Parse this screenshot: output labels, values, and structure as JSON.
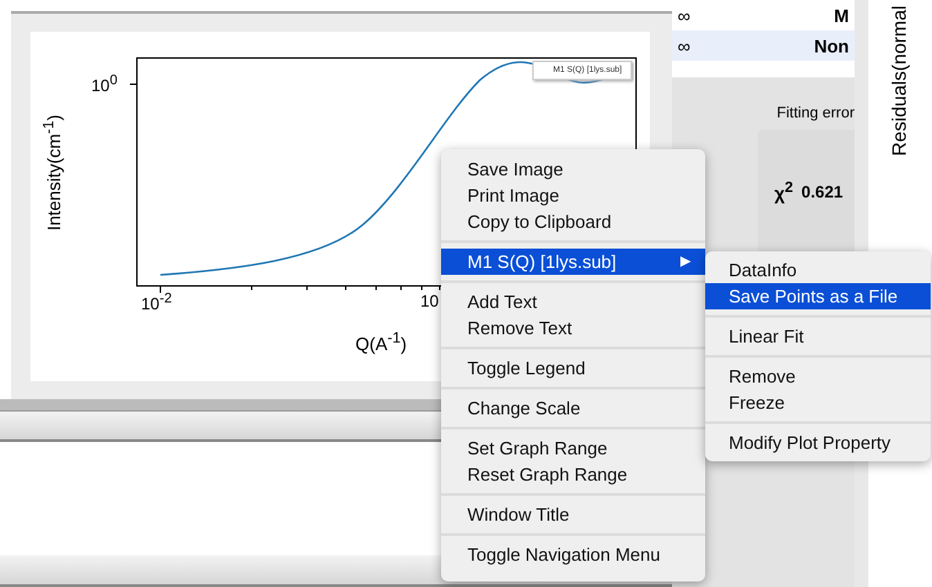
{
  "plot": {
    "y_tick": "10$^{0}$",
    "x_ticks": [
      "10$^{-2}$",
      "10"
    ],
    "ylabel": "Intensity(cm$^{-1}$)",
    "xlabel": "Q(A$^{-1}$)",
    "legend": "M1 S(Q) [1lys.sub]"
  },
  "table": {
    "rows": [
      {
        "cells": [
          "∞",
          "M"
        ],
        "selected": false
      },
      {
        "cells": [
          "∞",
          "Non"
        ],
        "selected": true
      }
    ]
  },
  "fit": {
    "label": "Fitting error",
    "chi": "χ$^{2}$",
    "value": "0.621"
  },
  "residuals_label": "Residuals(normal",
  "menu": {
    "groups": [
      {
        "items": [
          {
            "label": "Save Image",
            "selected": false
          },
          {
            "label": "Print Image",
            "selected": false
          },
          {
            "label": "Copy to Clipboard",
            "selected": false
          }
        ]
      },
      {
        "items": [
          {
            "label": "M1 S(Q) [1lys.sub]",
            "selected": true,
            "arrow": "▶"
          }
        ]
      },
      {
        "items": [
          {
            "label": "Add Text",
            "selected": false
          },
          {
            "label": "Remove Text",
            "selected": false
          }
        ]
      },
      {
        "items": [
          {
            "label": "Toggle Legend",
            "selected": false
          }
        ]
      },
      {
        "items": [
          {
            "label": "Change Scale",
            "selected": false
          }
        ]
      },
      {
        "items": [
          {
            "label": "Set Graph Range",
            "selected": false
          },
          {
            "label": "Reset Graph Range",
            "selected": false
          }
        ]
      },
      {
        "items": [
          {
            "label": "Window Title",
            "selected": false
          }
        ]
      },
      {
        "items": [
          {
            "label": "Toggle Navigation Menu",
            "selected": false
          }
        ]
      }
    ]
  },
  "submenu": {
    "groups": [
      {
        "items": [
          {
            "label": "DataInfo",
            "selected": false
          },
          {
            "label": "Save Points as a File",
            "selected": true
          }
        ]
      },
      {
        "items": [
          {
            "label": "Linear Fit",
            "selected": false
          }
        ]
      },
      {
        "items": [
          {
            "label": "Remove",
            "selected": false
          },
          {
            "label": "Freeze",
            "selected": false
          }
        ]
      },
      {
        "items": [
          {
            "label": "Modify Plot Property",
            "selected": false
          }
        ]
      }
    ]
  }
}
